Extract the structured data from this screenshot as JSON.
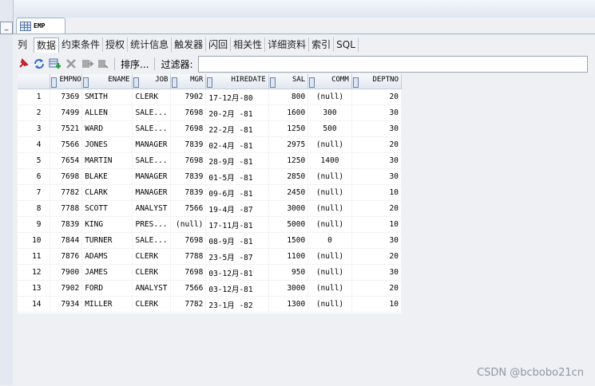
{
  "document_tab": {
    "title": "EMP"
  },
  "left_panel": {
    "min_button": "_"
  },
  "subtabs": [
    "列",
    "数据",
    "约束条件",
    "授权",
    "统计信息",
    "触发器",
    "闪回",
    "相关性",
    "详细资料",
    "索引",
    "SQL"
  ],
  "toolbar": {
    "icons": [
      "pin-icon",
      "refresh-icon",
      "insert-row-icon",
      "delete-row-icon",
      "commit-icon",
      "rollback-icon"
    ],
    "sort_label": "排序...",
    "filter_label": "过滤器:",
    "filter_value": ""
  },
  "table": {
    "columns": [
      "EMPNO",
      "ENAME",
      "JOB",
      "MGR",
      "HIREDATE",
      "SAL",
      "COMM",
      "DEPTNO"
    ],
    "rows": [
      [
        "1",
        "7369",
        "SMITH",
        "CLERK",
        "7902",
        "17-12月-80",
        "800",
        "(null)",
        "20"
      ],
      [
        "2",
        "7499",
        "ALLEN",
        "SALE...",
        "7698",
        "20-2月 -81",
        "1600",
        "300",
        "30"
      ],
      [
        "3",
        "7521",
        "WARD",
        "SALE...",
        "7698",
        "22-2月 -81",
        "1250",
        "500",
        "30"
      ],
      [
        "4",
        "7566",
        "JONES",
        "MANAGER",
        "7839",
        "02-4月 -81",
        "2975",
        "(null)",
        "20"
      ],
      [
        "5",
        "7654",
        "MARTIN",
        "SALE...",
        "7698",
        "28-9月 -81",
        "1250",
        "1400",
        "30"
      ],
      [
        "6",
        "7698",
        "BLAKE",
        "MANAGER",
        "7839",
        "01-5月 -81",
        "2850",
        "(null)",
        "30"
      ],
      [
        "7",
        "7782",
        "CLARK",
        "MANAGER",
        "7839",
        "09-6月 -81",
        "2450",
        "(null)",
        "10"
      ],
      [
        "8",
        "7788",
        "SCOTT",
        "ANALYST",
        "7566",
        "19-4月 -87",
        "3000",
        "(null)",
        "20"
      ],
      [
        "9",
        "7839",
        "KING",
        "PRES...",
        "(null)",
        "17-11月-81",
        "5000",
        "(null)",
        "10"
      ],
      [
        "10",
        "7844",
        "TURNER",
        "SALE...",
        "7698",
        "08-9月 -81",
        "1500",
        "0",
        "30"
      ],
      [
        "11",
        "7876",
        "ADAMS",
        "CLERK",
        "7788",
        "23-5月 -87",
        "1100",
        "(null)",
        "20"
      ],
      [
        "12",
        "7900",
        "JAMES",
        "CLERK",
        "7698",
        "03-12月-81",
        "950",
        "(null)",
        "30"
      ],
      [
        "13",
        "7902",
        "FORD",
        "ANALYST",
        "7566",
        "03-12月-81",
        "3000",
        "(null)",
        "20"
      ],
      [
        "14",
        "7934",
        "MILLER",
        "CLERK",
        "7782",
        "23-1月 -82",
        "1300",
        "(null)",
        "10"
      ]
    ]
  },
  "watermark": "CSDN @bcbobo21cn"
}
